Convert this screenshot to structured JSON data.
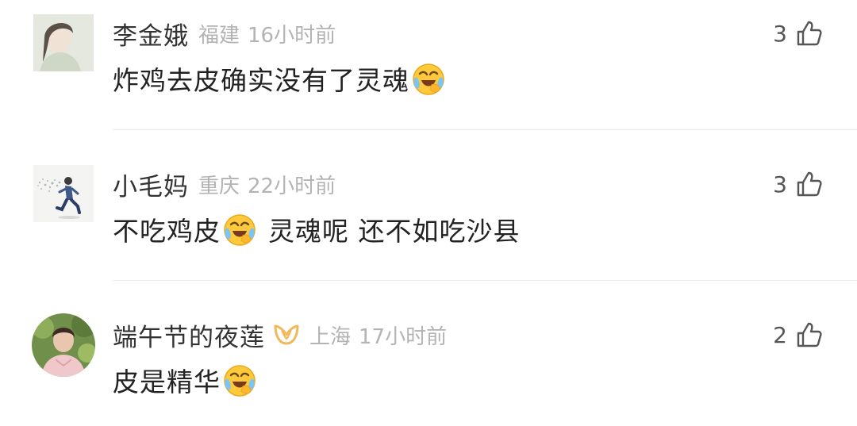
{
  "comments": [
    {
      "username": "李金娥",
      "location": "福建",
      "time": "16小时前",
      "text_parts": [
        "炸鸡去皮确实没有了灵魂"
      ],
      "likes": "3",
      "emoji": "laugh-cry-emoji",
      "avatar": "portrait-avatar"
    },
    {
      "username": "小毛妈",
      "location": "重庆",
      "time": "22小时前",
      "text_parts": [
        "不吃鸡皮",
        "灵魂呢 还不如吃沙县"
      ],
      "likes": "3",
      "emoji": "laugh-cry-emoji",
      "avatar": "running-figure-avatar"
    },
    {
      "username": "端午节的夜莲",
      "location": "上海",
      "time": "17小时前",
      "text_parts": [
        "皮是精华"
      ],
      "likes": "2",
      "emoji": "laugh-cry-emoji",
      "avatar": "child-photo-avatar",
      "badge": "vip-badge-icon"
    }
  ],
  "colors": {
    "username": "#333333",
    "meta": "#b3b3b3",
    "text": "#222222",
    "badge": "#f2b85c",
    "divider": "#ececec"
  }
}
